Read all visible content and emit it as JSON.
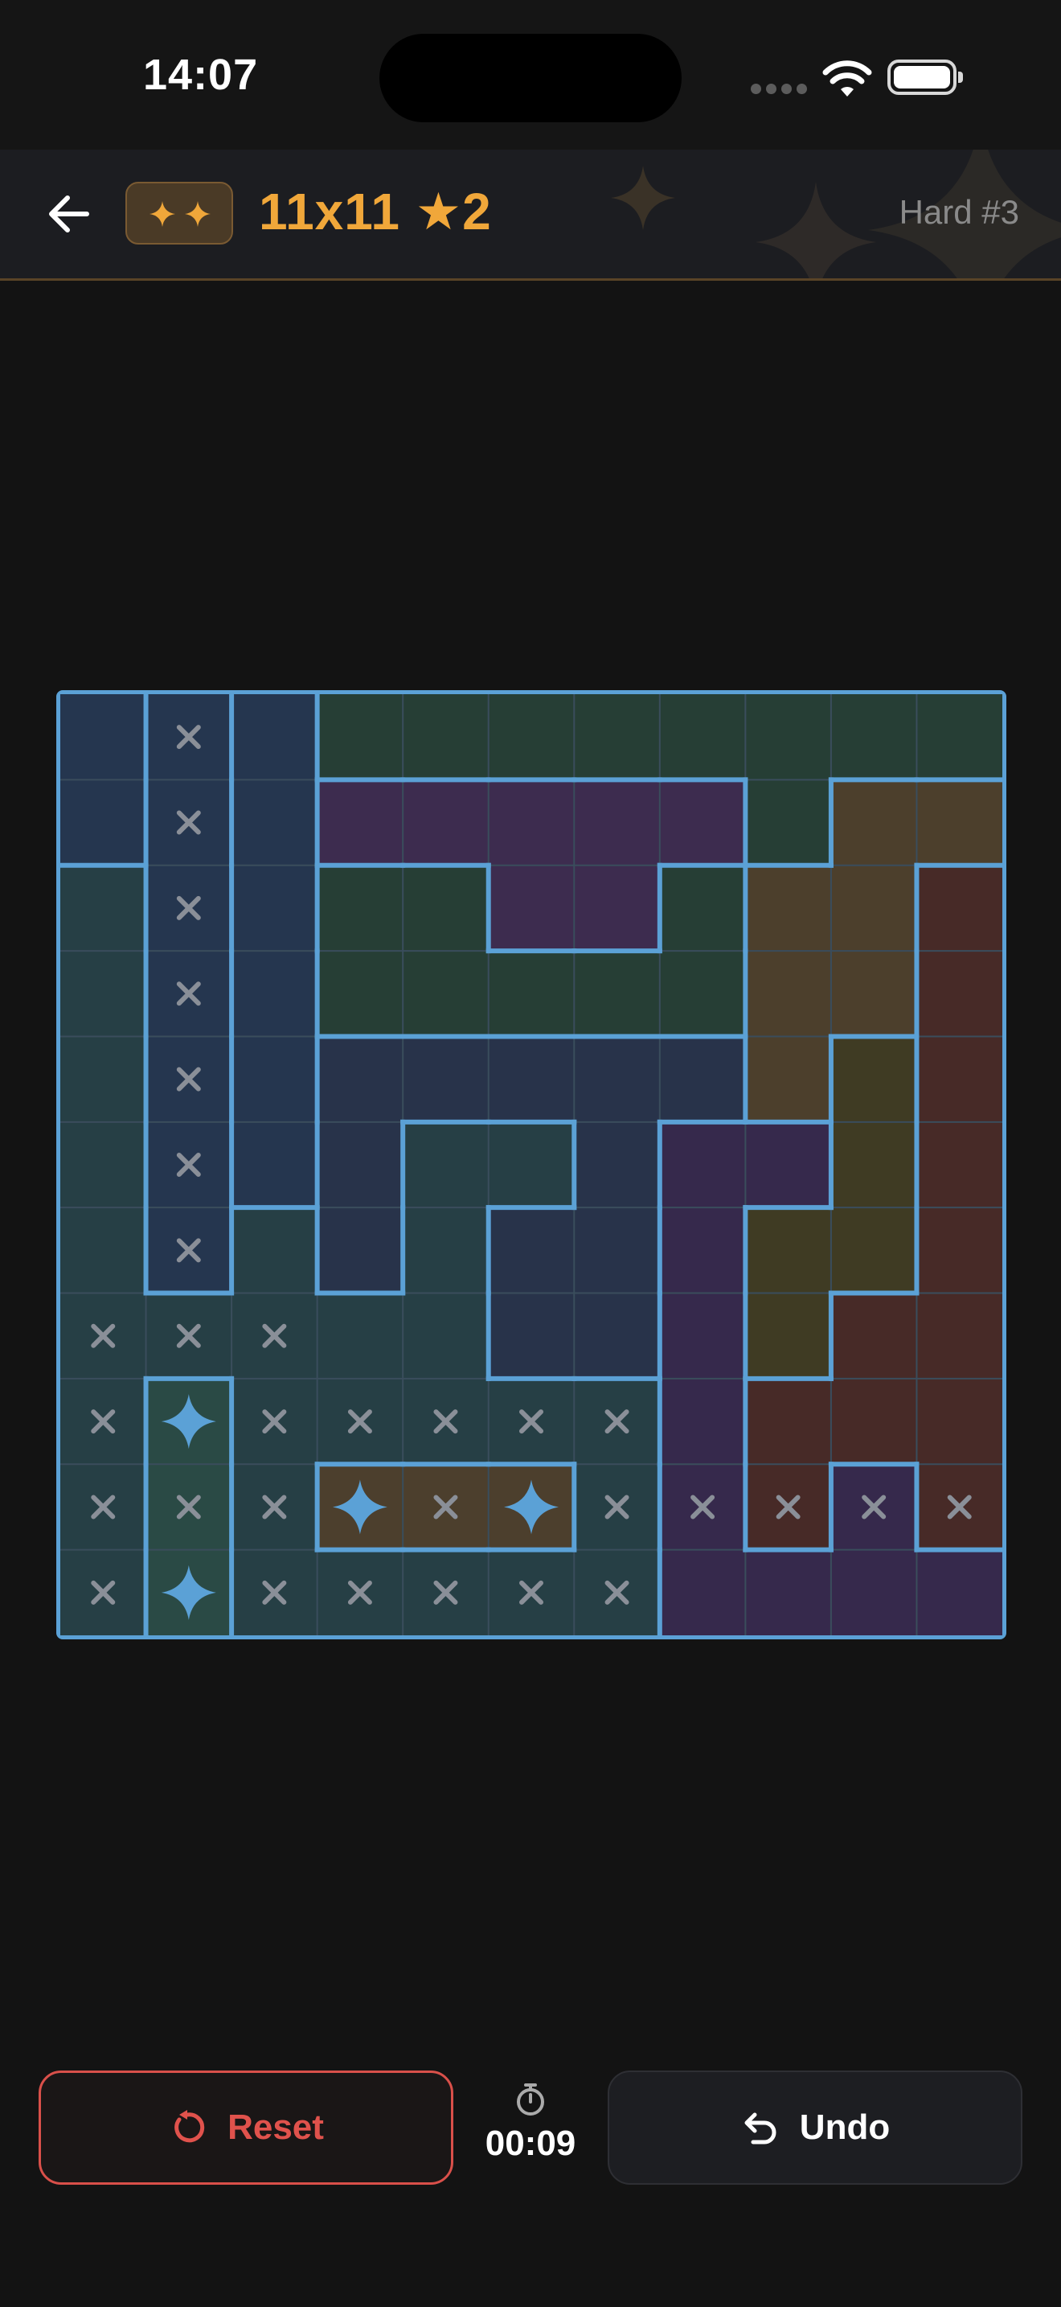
{
  "status_bar": {
    "time": "14:07"
  },
  "header": {
    "badge_icon": "two-sparkles-icon",
    "title": "11x11 ★2",
    "level": "Hard #3",
    "accent": "#f0a73a"
  },
  "board": {
    "size": 11,
    "stars_per_region": 2,
    "region_rows": [
      "AXAGGGGGGGG",
      "AXAPPPPPGBBG",
      "TXAGGPPGBBR",
      "TXAGGGGGBBR",
      "TXANNNNNBOR",
      "TXANTTNVVOR",
      "TXTNTNNVOOR",
      "TTTTTNNVORR",
      "TSTTTTTVRRR",
      "TSTCCCTVRVR",
      "TSTTTTTVVVV"
    ],
    "region_colors": {
      "A": "#25364f",
      "X": "#25364f",
      "G": "#263e35",
      "P": "#3d2c4f",
      "B": "#4c3f2c",
      "R": "#472a27",
      "T": "#263f45",
      "N": "#28334a",
      "O": "#3f3b23",
      "V": "#36294c",
      "S": "#2a4a45",
      "C": "#4c3f2d"
    },
    "stars": [
      [
        8,
        1
      ],
      [
        9,
        3
      ],
      [
        9,
        5
      ],
      [
        10,
        1
      ]
    ],
    "crosses": [
      [
        0,
        1
      ],
      [
        1,
        1
      ],
      [
        2,
        1
      ],
      [
        3,
        1
      ],
      [
        4,
        1
      ],
      [
        5,
        1
      ],
      [
        6,
        1
      ],
      [
        7,
        0
      ],
      [
        7,
        1
      ],
      [
        7,
        2
      ],
      [
        8,
        0
      ],
      [
        8,
        2
      ],
      [
        8,
        3
      ],
      [
        8,
        4
      ],
      [
        8,
        5
      ],
      [
        8,
        6
      ],
      [
        9,
        0
      ],
      [
        9,
        1
      ],
      [
        9,
        2
      ],
      [
        9,
        4
      ],
      [
        9,
        6
      ],
      [
        9,
        7
      ],
      [
        9,
        8
      ],
      [
        9,
        9
      ],
      [
        9,
        10
      ],
      [
        10,
        0
      ],
      [
        10,
        2
      ],
      [
        10,
        3
      ],
      [
        10,
        4
      ],
      [
        10,
        5
      ],
      [
        10,
        6
      ]
    ],
    "border_color": "#5ba1d6"
  },
  "controls": {
    "reset_label": "Reset",
    "undo_label": "Undo",
    "timer": "00:09",
    "reset_color": "#e0524c"
  }
}
